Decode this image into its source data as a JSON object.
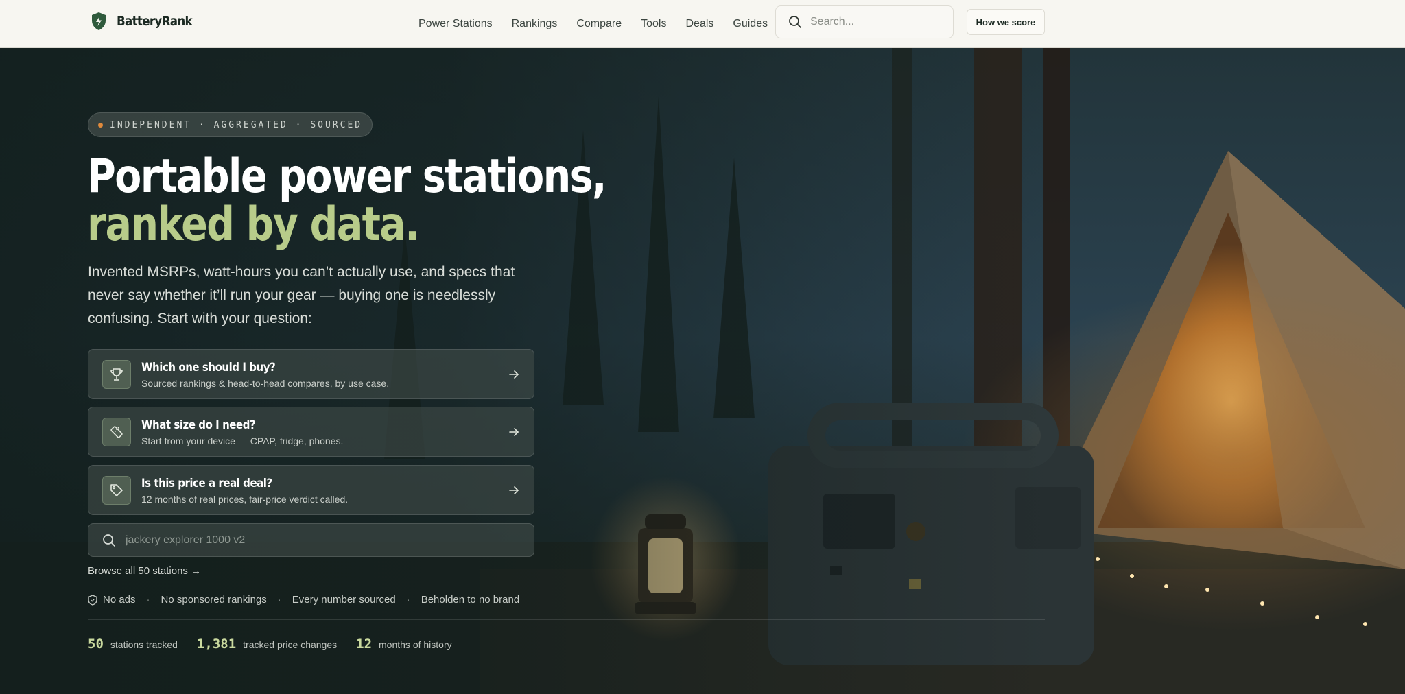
{
  "brand": {
    "name": "BatteryRank",
    "accent": "#2f5a3c"
  },
  "nav": {
    "links": [
      "Power Stations",
      "Rankings",
      "Compare",
      "Tools",
      "Deals",
      "Guides"
    ],
    "search_placeholder": "Search...",
    "score_button": "How we score"
  },
  "hero": {
    "pill": "INDEPENDENT · AGGREGATED · SOURCED",
    "headline_1": "Portable power stations,",
    "headline_2": "ranked by data.",
    "lede": "Invented MSRPs, watt-hours you can’t actually use, and specs that never say whether it’ll run your gear — buying one is needlessly confusing. Start with your question:",
    "questions": [
      {
        "title": "Which one should I buy?",
        "subtitle": "Sourced rankings & head-to-head compares, by use case.",
        "icon": "trophy-icon"
      },
      {
        "title": "What size do I need?",
        "subtitle": "Start from your device — CPAP, fridge, phones.",
        "icon": "ruler-icon"
      },
      {
        "title": "Is this price a real deal?",
        "subtitle": "12 months of real prices, fair-price verdict called.",
        "icon": "price-tag-icon"
      }
    ],
    "search_placeholder": "jackery explorer 1000 v2",
    "browse_link": "Browse all 50 stations →",
    "trust": [
      "No ads",
      "No sponsored rankings",
      "Every number sourced",
      "Beholden to no brand"
    ],
    "stats": [
      {
        "value": "50",
        "label": "stations tracked"
      },
      {
        "value": "1,381",
        "label": "tracked price changes"
      },
      {
        "value": "12",
        "label": "months of history"
      }
    ]
  },
  "colors": {
    "headline_accent": "#b8cc8a",
    "stat_accent": "#c9d99e",
    "pill_dot": "#e08a3c"
  }
}
